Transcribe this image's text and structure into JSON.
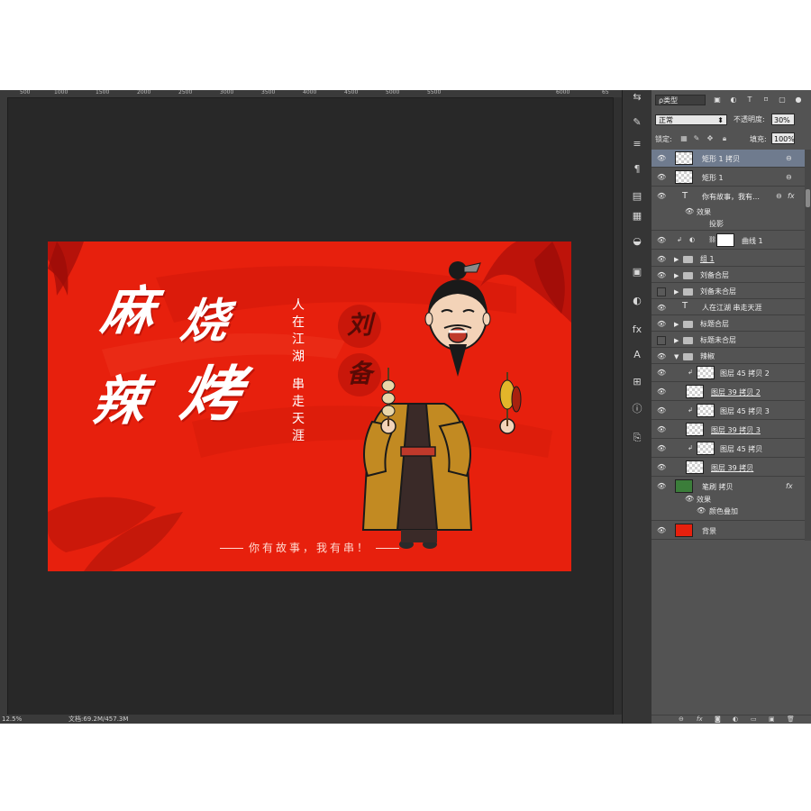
{
  "ruler": {
    "ticks": [
      "500",
      "1000",
      "1500",
      "2000",
      "2500",
      "3000",
      "3500",
      "4000",
      "4500",
      "5000",
      "5500",
      "6000",
      "65"
    ]
  },
  "status": {
    "zoom": "12.5%",
    "doc_info": "文档:69.2M/457.3M"
  },
  "artwork": {
    "title_chars": [
      "麻",
      "烧",
      "辣",
      "烤"
    ],
    "subtitle_col1": "人在江湖",
    "subtitle_col2": "串走天涯",
    "character_name": [
      "刘",
      "备"
    ],
    "slogan": "你有故事，我有串！",
    "colors": {
      "background": "#e7200d",
      "robe": "#c28a22",
      "inner_robe": "#3a2a28"
    }
  },
  "tools": [
    "history-icon",
    "brush-settings-icon",
    "character-icon",
    "paragraph-icon",
    "notes-icon",
    "swatches-icon",
    "color-icon",
    "navigator-icon",
    "adjustments-icon",
    "styles-icon",
    "type-icon",
    "transform-icon",
    "info-icon",
    "layer-comps-icon"
  ],
  "layers_panel": {
    "filter_label": "ρ类型",
    "blend_mode": "正常",
    "opacity_label": "不透明度:",
    "opacity_value": "30%",
    "lock_label": "锁定:",
    "fill_label": "填充:",
    "fill_value": "100%",
    "layers": [
      {
        "name": "矩形 1 拷贝",
        "kind": "shape",
        "visible": true,
        "selected": true,
        "link": true
      },
      {
        "name": "矩形 1",
        "kind": "shape",
        "visible": true,
        "link": true
      },
      {
        "name": "你有故事，我有…",
        "kind": "text",
        "visible": true,
        "link": true,
        "fx": true
      },
      {
        "name": "曲线 1",
        "kind": "adjustment",
        "visible": true
      },
      {
        "name": "组 1",
        "kind": "group",
        "visible": true,
        "underline": true
      },
      {
        "name": "刘备合层",
        "kind": "group",
        "visible": true
      },
      {
        "name": "刘备未合层",
        "kind": "group",
        "visible": false
      },
      {
        "name": "人在江湖 串走天涯",
        "kind": "text",
        "visible": true
      },
      {
        "name": "标题合层",
        "kind": "group",
        "visible": true
      },
      {
        "name": "标题未合层",
        "kind": "group",
        "visible": false
      },
      {
        "name": "辣椒",
        "kind": "group-open",
        "visible": true
      },
      {
        "name": "图层 45 拷贝 2",
        "kind": "pixel-clip",
        "visible": true
      },
      {
        "name": "图层 39 拷贝 2",
        "kind": "pixel",
        "visible": true,
        "underline": true
      },
      {
        "name": "图层 45 拷贝 3",
        "kind": "pixel-clip",
        "visible": true
      },
      {
        "name": "图层 39 拷贝 3",
        "kind": "pixel",
        "visible": true,
        "underline": true
      },
      {
        "name": "图层 45 拷贝",
        "kind": "pixel-clip",
        "visible": true
      },
      {
        "name": "图层 39 拷贝",
        "kind": "pixel",
        "visible": true,
        "underline": true
      },
      {
        "name": "笔刷 拷贝",
        "kind": "pixel-brush",
        "visible": true,
        "fx": true
      },
      {
        "name": "背景",
        "kind": "background",
        "visible": true
      }
    ],
    "effects_text": {
      "header": "效果",
      "item": "投影"
    },
    "effects_brush": {
      "header": "效果",
      "item": "颜色叠加"
    },
    "footer_icons": [
      "link-icon",
      "fx-icon",
      "mask-icon",
      "adjustment-icon",
      "folder-icon",
      "new-layer-icon",
      "trash-icon"
    ]
  }
}
